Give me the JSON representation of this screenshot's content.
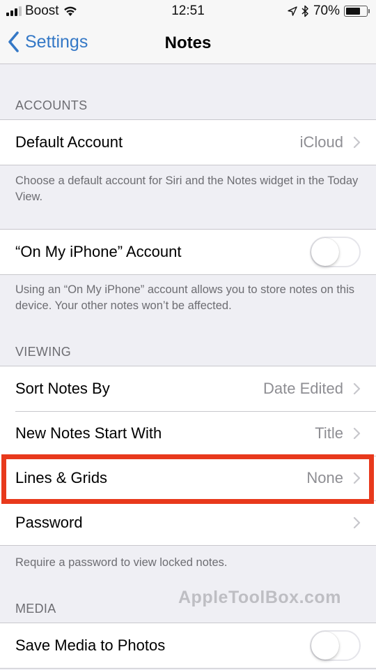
{
  "status_bar": {
    "signal_bars_total": 4,
    "signal_bars_filled": 3,
    "carrier": "Boost",
    "wifi_icon": "wifi-icon",
    "time": "12:51",
    "location_icon": "location-arrow-icon",
    "bluetooth_icon": "bluetooth-icon",
    "battery_percent_label": "70%",
    "battery_level": 0.7
  },
  "nav": {
    "back_label": "Settings",
    "title": "Notes"
  },
  "sections": {
    "accounts": {
      "header": "ACCOUNTS",
      "default_account": {
        "label": "Default Account",
        "value": "iCloud"
      },
      "footer": "Choose a default account for Siri and the Notes widget in the Today View."
    },
    "on_my_iphone": {
      "label": "“On My iPhone” Account",
      "enabled": false,
      "footer": "Using an “On My iPhone” account allows you to store notes on this device. Your other notes won’t be affected."
    },
    "viewing": {
      "header": "VIEWING",
      "rows": [
        {
          "label": "Sort Notes By",
          "value": "Date Edited"
        },
        {
          "label": "New Notes Start With",
          "value": "Title"
        },
        {
          "label": "Lines & Grids",
          "value": "None",
          "highlighted": true
        },
        {
          "label": "Password",
          "value": ""
        }
      ],
      "footer": "Require a password to view locked notes."
    },
    "media": {
      "header": "MEDIA",
      "save_media": {
        "label": "Save Media to Photos",
        "enabled": false
      }
    }
  },
  "annotation": {
    "highlight_color": "#e8391c"
  },
  "watermark": "AppleToolBox.com",
  "colors": {
    "accent": "#3478c6",
    "background": "#efeff4",
    "secondary_text": "#8e8e93",
    "section_text": "#6d6d72"
  }
}
